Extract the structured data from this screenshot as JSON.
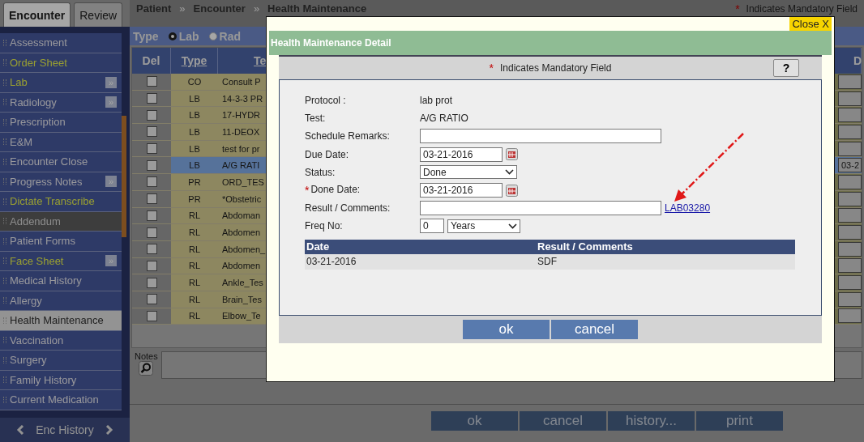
{
  "sidebar": {
    "tabs": [
      {
        "label": "Encounter",
        "selected": true
      },
      {
        "label": "Review",
        "selected": false
      }
    ],
    "items": [
      {
        "label": "Assessment",
        "kind": "normal",
        "selected": false
      },
      {
        "label": "Order Sheet",
        "kind": "accent",
        "selected": false
      },
      {
        "label": "Lab",
        "kind": "accent",
        "selected": false,
        "expand": "»"
      },
      {
        "label": "Radiology",
        "kind": "normal",
        "selected": false,
        "expand": "»"
      },
      {
        "label": "Prescription",
        "kind": "normal",
        "selected": false
      },
      {
        "label": "E&M",
        "kind": "normal",
        "selected": false
      },
      {
        "label": "Encounter Close",
        "kind": "normal",
        "selected": false
      },
      {
        "label": "Progress Notes",
        "kind": "normal",
        "selected": false,
        "expand": "»"
      },
      {
        "label": "Dictate Transcribe",
        "kind": "accent",
        "selected": false
      },
      {
        "label": "Addendum",
        "kind": "disabled",
        "selected": false
      },
      {
        "label": "Patient Forms",
        "kind": "normal",
        "selected": false
      },
      {
        "label": "Face Sheet",
        "kind": "accent",
        "selected": false,
        "expand": "»"
      },
      {
        "label": "Medical History",
        "kind": "normal",
        "selected": false
      },
      {
        "label": "Allergy",
        "kind": "normal",
        "selected": false
      },
      {
        "label": "Health Maintenance",
        "kind": "normal",
        "selected": true
      },
      {
        "label": "Vaccination",
        "kind": "normal",
        "selected": false
      },
      {
        "label": "Surgery",
        "kind": "normal",
        "selected": false
      },
      {
        "label": "Family History",
        "kind": "normal",
        "selected": false
      },
      {
        "label": "Current Medication",
        "kind": "normal",
        "selected": false
      }
    ],
    "footer": "Enc History"
  },
  "breadcrumb": {
    "items": [
      "Patient",
      "Encounter",
      "Health Maintenance"
    ],
    "separator": "»"
  },
  "mandatory_note": {
    "mark": "*",
    "text": "Indicates Mandatory Field"
  },
  "filter": {
    "label": "Type",
    "options": [
      {
        "label": "Lab",
        "selected": true
      },
      {
        "label": "Rad",
        "selected": false
      }
    ]
  },
  "table": {
    "columns": [
      "Del",
      "Type",
      "Te",
      "D"
    ],
    "rows": [
      {
        "checked": false,
        "type": "CO",
        "test": "Consult P",
        "selected": false
      },
      {
        "checked": false,
        "type": "LB",
        "test": "14-3-3 PR",
        "selected": false
      },
      {
        "checked": false,
        "type": "LB",
        "test": "17-HYDR",
        "selected": false
      },
      {
        "checked": false,
        "type": "LB",
        "test": "11-DEOX",
        "selected": false
      },
      {
        "checked": false,
        "type": "LB",
        "test": "test for pr",
        "selected": false
      },
      {
        "checked": false,
        "type": "LB",
        "test": "A/G RATI",
        "selected": true,
        "date": "03-2"
      },
      {
        "checked": false,
        "type": "PR",
        "test": "ORD_TES",
        "selected": false
      },
      {
        "checked": false,
        "type": "PR",
        "test": "*Obstetric",
        "selected": false
      },
      {
        "checked": false,
        "type": "RL",
        "test": "Abdoman",
        "selected": false
      },
      {
        "checked": false,
        "type": "RL",
        "test": "Abdomen",
        "selected": false
      },
      {
        "checked": false,
        "type": "RL",
        "test": "Abdomen_",
        "selected": false
      },
      {
        "checked": false,
        "type": "RL",
        "test": "Abdomen",
        "selected": false
      },
      {
        "checked": false,
        "type": "RL",
        "test": "Ankle_Tes",
        "selected": false
      },
      {
        "checked": false,
        "type": "RL",
        "test": "Brain_Tes",
        "selected": false
      },
      {
        "checked": false,
        "type": "RL",
        "test": "Elbow_Te",
        "selected": false
      }
    ]
  },
  "notes": {
    "label": "Notes"
  },
  "buttons": [
    "ok",
    "cancel",
    "history...",
    "print"
  ],
  "dialog": {
    "title": "Health Maintenance Detail",
    "close": "Close X",
    "mandatory_note": {
      "mark": "*",
      "text": "Indicates Mandatory Field"
    },
    "help": "?",
    "fields": [
      {
        "kind": "text",
        "label": "Protocol :",
        "value": "lab prot"
      },
      {
        "kind": "text",
        "label": "Test:",
        "value": "A/G RATIO"
      },
      {
        "kind": "input",
        "label": "Schedule Remarks:"
      },
      {
        "kind": "date",
        "label": "Due Date:",
        "value": "03-21-2016"
      },
      {
        "kind": "select",
        "label": "Status:",
        "value": "Done"
      },
      {
        "kind": "date",
        "label": "Done Date:",
        "value": "03-21-2016",
        "mark": "*"
      },
      {
        "kind": "input",
        "label": "Result / Comments:",
        "link": "LAB03280"
      },
      {
        "kind": "freq",
        "label": "Freq No:",
        "value": "0",
        "unit": "Years"
      }
    ],
    "history": {
      "columns": [
        "Date",
        "Result / Comments"
      ],
      "rows": [
        [
          "03-21-2016",
          "SDF"
        ]
      ]
    },
    "buttons": [
      "ok",
      "cancel"
    ]
  }
}
